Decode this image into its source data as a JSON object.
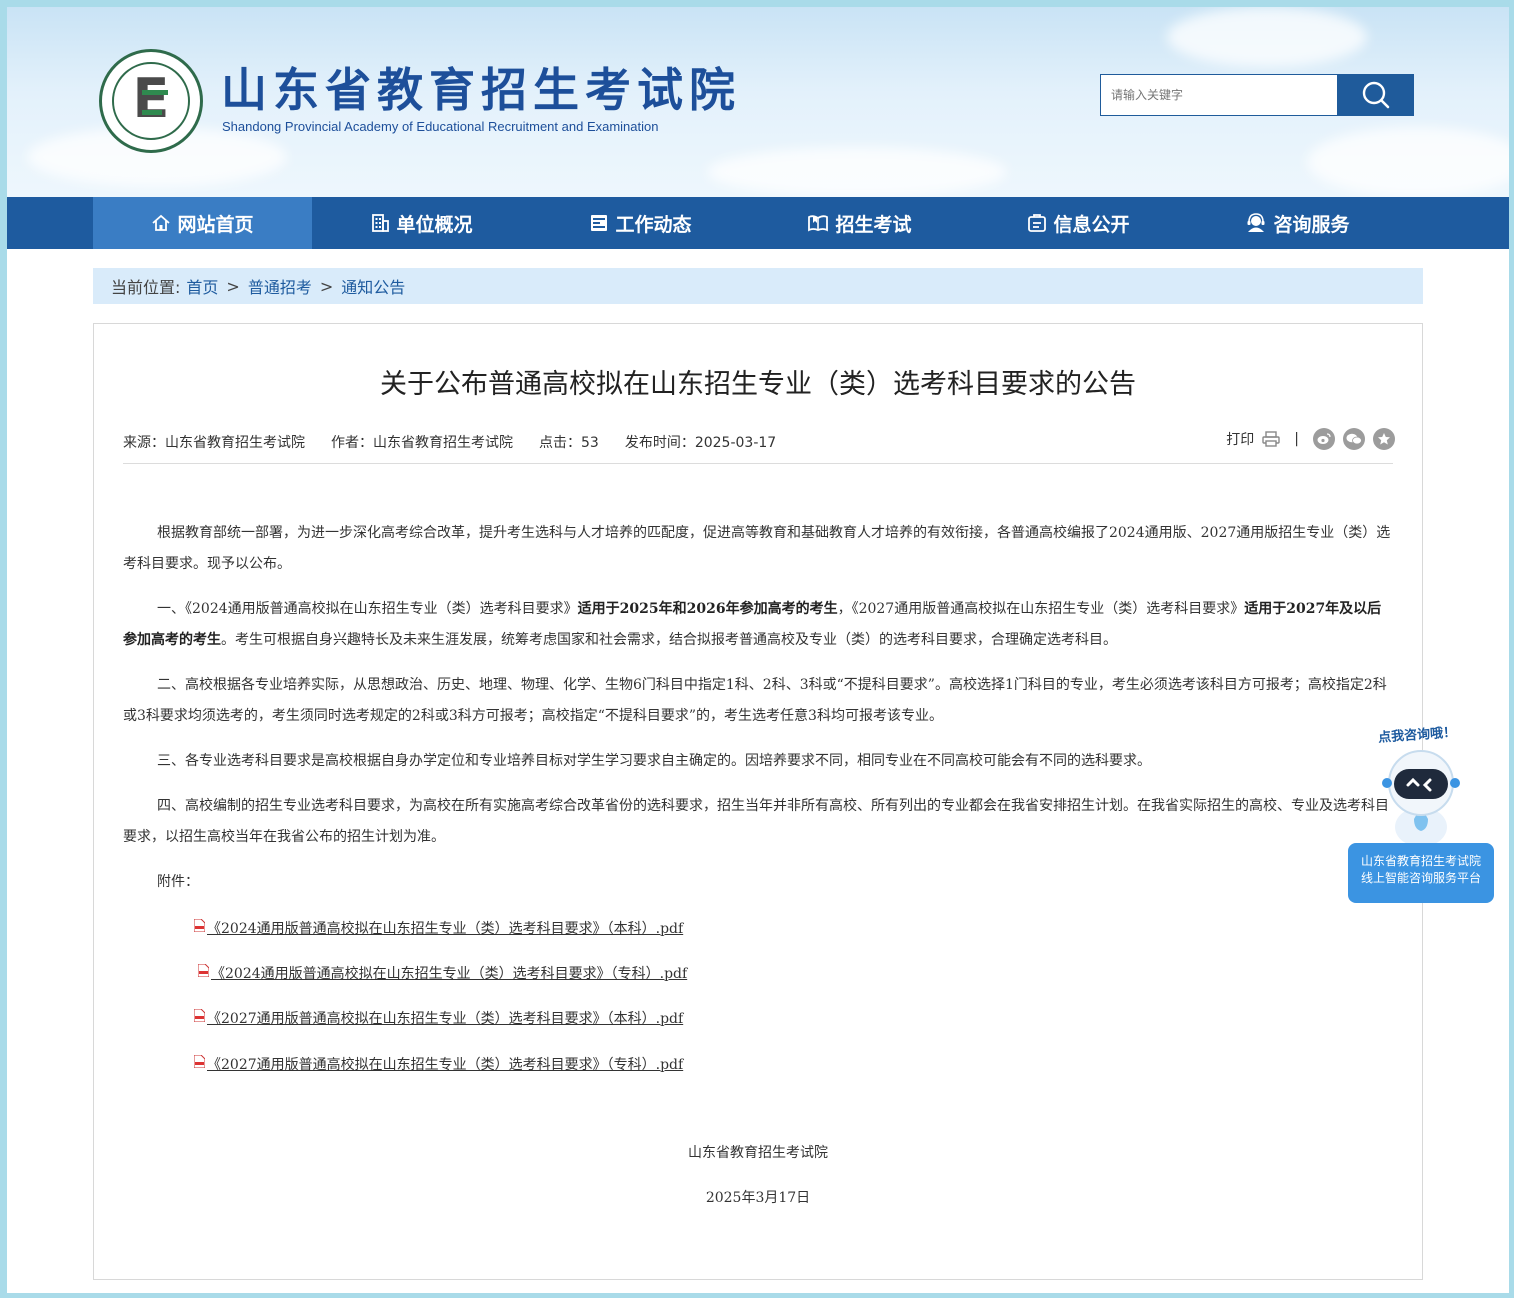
{
  "header": {
    "title": "山东省教育招生考试院",
    "subtitle": "Shandong Provincial Academy of Educational Recruitment and Examination",
    "logo_name": "logo-icon",
    "search_placeholder": "请输入关键字",
    "brand_color": "#1e5b9f"
  },
  "nav": {
    "items": [
      {
        "label": "网站首页",
        "icon": "home-icon",
        "active": true
      },
      {
        "label": "单位概况",
        "icon": "building-icon"
      },
      {
        "label": "工作动态",
        "icon": "news-icon"
      },
      {
        "label": "招生考试",
        "icon": "book-icon"
      },
      {
        "label": "信息公开",
        "icon": "info-icon"
      },
      {
        "label": "咨询服务",
        "icon": "support-icon"
      }
    ]
  },
  "breadcrumb": {
    "prefix": "当前位置:",
    "items": [
      "首页",
      "普通招考",
      "通知公告"
    ],
    "sep": ">"
  },
  "article": {
    "title": "关于公布普通高校拟在山东招生专业（类）选考科目要求的公告",
    "meta": {
      "source": "来源：山东省教育招生考试院",
      "author": "作者：山东省教育招生考试院",
      "clicks": "点击：53",
      "date": "发布时间：2025-03-17"
    },
    "print_label": "打印",
    "separator": "|",
    "paragraphs": {
      "p1": "根据教育部统一部署，为进一步深化高考综合改革，提升考生选科与人才培养的匹配度，促进高等教育和基础教育人才培养的有效衔接，各普通高校编报了2024通用版、2027通用版招生专业（类）选考科目要求。现予以公布。",
      "p2a": "一、《2024通用版普通高校拟在山东招生专业（类）选考科目要求》",
      "p2b": "适用于2025年和2026年参加高考的考生",
      "p2c": "，《2027通用版普通高校拟在山东招生专业（类）选考科目要求》",
      "p2d": "适用于2027年及以后参加高考的考生",
      "p2e": "。考生可根据自身兴趣特长及未来生涯发展，统筹考虑国家和社会需求，结合拟报考普通高校及专业（类）的选考科目要求，合理确定选考科目。",
      "p3": "二、高校根据各专业培养实际，从思想政治、历史、地理、物理、化学、生物6门科目中指定1科、2科、3科或“不提科目要求”。高校选择1门科目的专业，考生必须选考该科目方可报考；高校指定2科或3科要求均须选考的，考生须同时选考规定的2科或3科方可报考；高校指定“不提科目要求”的，考生选考任意3科均可报考该专业。",
      "p4": "三、各专业选考科目要求是高校根据自身办学定位和专业培养目标对学生学习要求自主确定的。因培养要求不同，相同专业在不同高校可能会有不同的选科要求。",
      "p5": "四、高校编制的招生专业选考科目要求，为高校在所有实施高考综合改革省份的选科要求，招生当年并非所有高校、所有列出的专业都会在我省安排招生计划。在我省实际招生的高校、专业及选考科目要求，以招生高校当年在我省公布的招生计划为准。",
      "attach_label": "附件："
    },
    "attachments": [
      "《2024通用版普通高校拟在山东招生专业（类）选考科目要求》（本科）.pdf",
      "《2024通用版普通高校拟在山东招生专业（类）选考科目要求》（专科）.pdf",
      "《2027通用版普通高校拟在山东招生专业（类）选考科目要求》（本科）.pdf",
      "《2027通用版普通高校拟在山东招生专业（类）选考科目要求》（专科）.pdf"
    ],
    "signature": "山东省教育招生考试院",
    "sign_date": "2025年3月17日"
  },
  "robot": {
    "bubble": "点我咨询哦！",
    "line1": "山东省教育招生考试院",
    "line2": "线上智能咨询服务平台"
  }
}
